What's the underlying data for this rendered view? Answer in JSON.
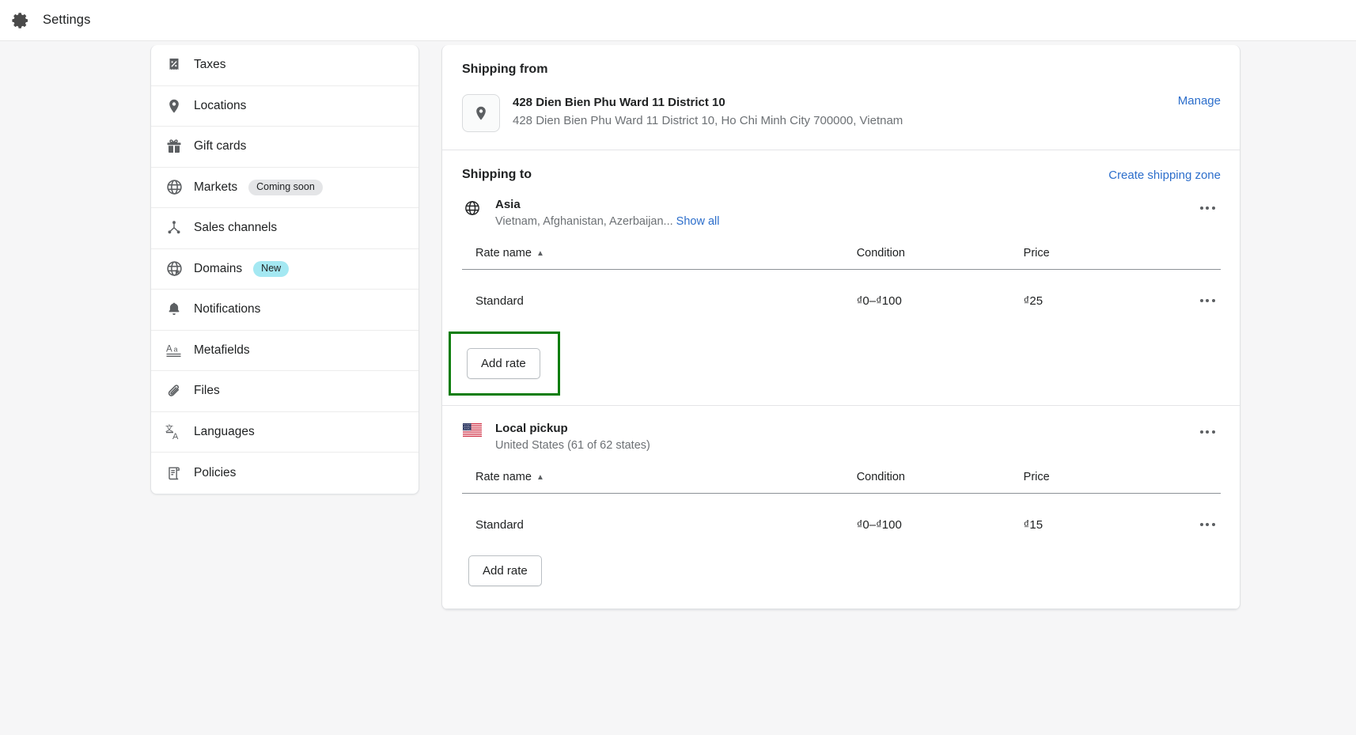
{
  "topbar": {
    "title": "Settings",
    "icon": "gear-icon"
  },
  "sidebar": {
    "items": [
      {
        "label": "Taxes",
        "icon": "tax-receipt-icon",
        "badge": null
      },
      {
        "label": "Locations",
        "icon": "map-pin-icon",
        "badge": null
      },
      {
        "label": "Gift cards",
        "icon": "gift-icon",
        "badge": null
      },
      {
        "label": "Markets",
        "icon": "globe-icon",
        "badge": "Coming soon",
        "badge_style": "gray"
      },
      {
        "label": "Sales channels",
        "icon": "channels-icon",
        "badge": null
      },
      {
        "label": "Domains",
        "icon": "globe-arrow-icon",
        "badge": "New",
        "badge_style": "new"
      },
      {
        "label": "Notifications",
        "icon": "bell-icon",
        "badge": null
      },
      {
        "label": "Metafields",
        "icon": "text-aa-icon",
        "badge": null
      },
      {
        "label": "Files",
        "icon": "paperclip-icon",
        "badge": null
      },
      {
        "label": "Languages",
        "icon": "translate-icon",
        "badge": null
      },
      {
        "label": "Policies",
        "icon": "scroll-document-icon",
        "badge": null
      }
    ]
  },
  "shipping_from": {
    "title": "Shipping from",
    "location_name": "428 Dien Bien Phu Ward 11 District 10",
    "location_address": "428 Dien Bien Phu Ward 11 District 10, Ho Chi Minh City 700000, Vietnam",
    "manage_label": "Manage"
  },
  "shipping_to": {
    "title": "Shipping to",
    "create_zone_label": "Create shipping zone",
    "zones": [
      {
        "name": "Asia",
        "flag": "globe-icon",
        "countries": "Vietnam, Afghanistan, Azerbaijan...",
        "show_all_label": "Show all",
        "columns": {
          "rate_name": "Rate name",
          "condition": "Condition",
          "price": "Price"
        },
        "rates": [
          {
            "name": "Standard",
            "condition": "₫0–₫100",
            "price": "₫25"
          }
        ],
        "add_rate_label": "Add rate",
        "highlighted": true
      },
      {
        "name": "Local pickup",
        "flag": "us-flag-icon",
        "countries": "United States (61 of 62 states)",
        "show_all_label": null,
        "columns": {
          "rate_name": "Rate name",
          "condition": "Condition",
          "price": "Price"
        },
        "rates": [
          {
            "name": "Standard",
            "condition": "₫0–₫100",
            "price": "₫15"
          }
        ],
        "add_rate_label": "Add rate",
        "highlighted": false
      }
    ]
  },
  "colors": {
    "link": "#2c6ecb",
    "highlight_border": "#0a7d0a",
    "badge_new_bg": "#a4e8f2",
    "badge_gray_bg": "#e4e5e7",
    "page_bg": "#f6f6f7"
  }
}
